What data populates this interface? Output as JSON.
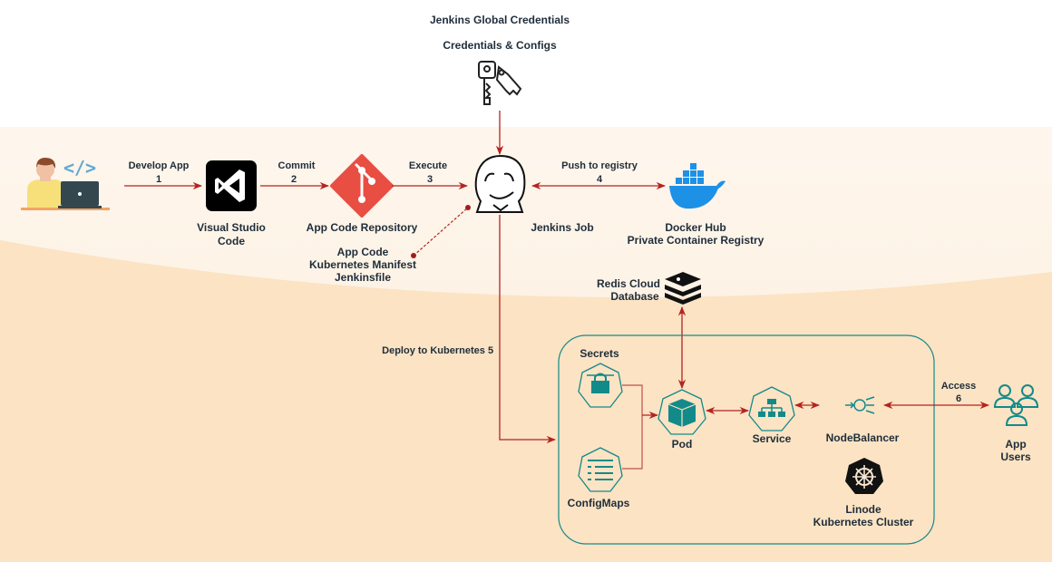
{
  "title_lines": [
    "Jenkins Global Credentials",
    "Credentials & Configs"
  ],
  "nodes": {
    "developer": {
      "icon": "developer-laptop-icon"
    },
    "vscode": {
      "label_lines": [
        "Visual Studio",
        "Code"
      ],
      "icon": "visual-studio-code-icon"
    },
    "repo": {
      "label": "App Code Repository",
      "icon": "git-icon"
    },
    "repo_contents": [
      "App Code",
      "Kubernetes Manifest",
      "Jenkinsfile"
    ],
    "jenkins": {
      "label": "Jenkins Job",
      "icon": "jenkins-icon"
    },
    "credentials": {
      "icon": "keys-icon"
    },
    "docker": {
      "label_lines": [
        "Docker Hub",
        "Private Container Registry"
      ],
      "icon": "docker-whale-icon"
    },
    "redis": {
      "label_lines": [
        "Redis Cloud",
        "Database"
      ],
      "icon": "redis-icon"
    },
    "secrets": {
      "label": "Secrets",
      "icon": "secret-lock-icon"
    },
    "configmaps": {
      "label": "ConfigMaps",
      "icon": "configmap-list-icon"
    },
    "pod": {
      "label": "Pod",
      "icon": "pod-cube-icon"
    },
    "service": {
      "label": "Service",
      "icon": "service-network-icon"
    },
    "nodebalancer": {
      "label": "NodeBalancer",
      "icon": "load-balancer-icon"
    },
    "cluster": {
      "label_lines": [
        "Linode",
        "Kubernetes Cluster"
      ],
      "icon": "kubernetes-helm-icon"
    },
    "users": {
      "label_lines": [
        "App",
        "Users"
      ],
      "icon": "users-group-icon"
    }
  },
  "edges": [
    {
      "label": "Develop App",
      "step": "1"
    },
    {
      "label": "Commit",
      "step": "2"
    },
    {
      "label": "Execute",
      "step": "3"
    },
    {
      "label": "Push to registry",
      "step": "4"
    },
    {
      "label": "Deploy to Kubernetes",
      "step": "5"
    },
    {
      "label": "Access",
      "step": "6"
    }
  ],
  "colors": {
    "arrow": "#b5231f",
    "k8s_teal": "#138a8a",
    "background_peach": "#fbe3c4",
    "text": "#1f2d3a"
  }
}
